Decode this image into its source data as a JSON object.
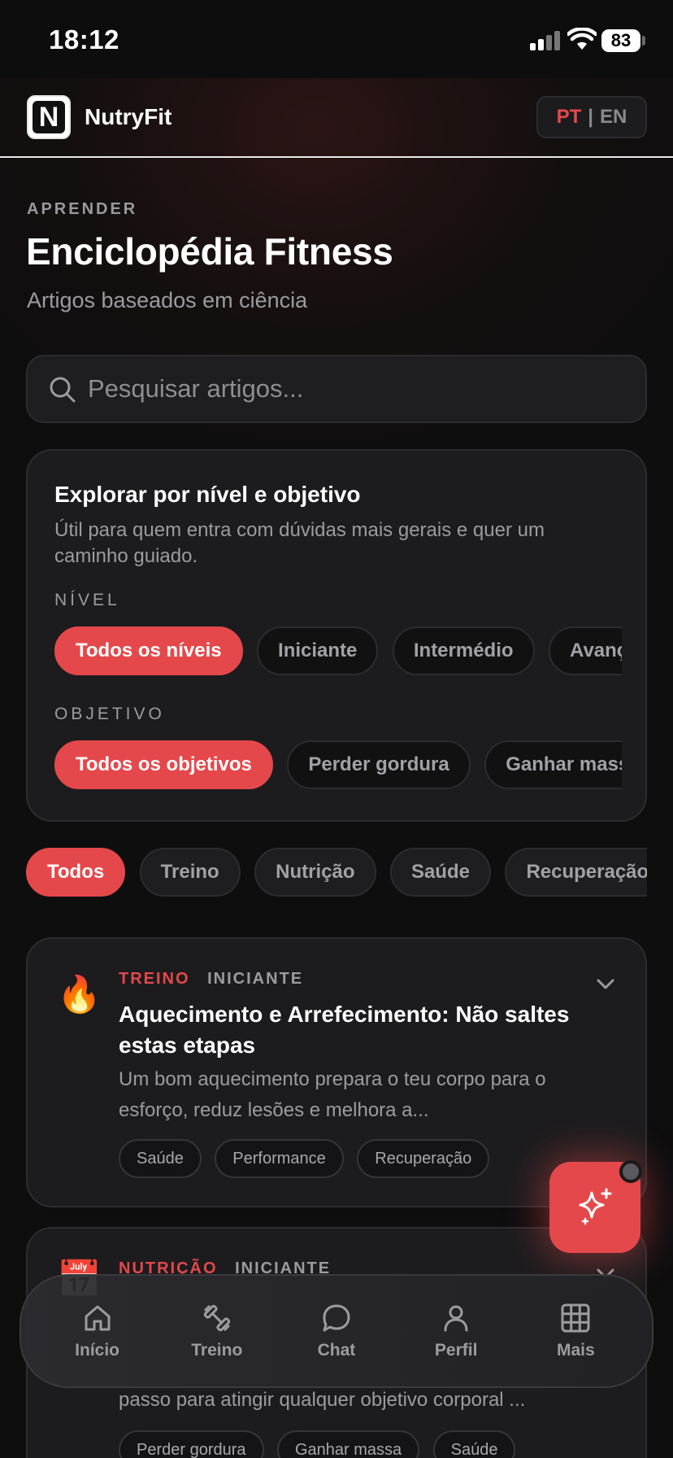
{
  "status_bar": {
    "time": "18:12",
    "battery": "83"
  },
  "header": {
    "brand": "NutryFit",
    "logo_letter": "N",
    "lang_pt": "PT",
    "lang_sep": "|",
    "lang_en": "EN"
  },
  "page": {
    "eyebrow": "APRENDER",
    "title": "Enciclopédia Fitness",
    "subtitle": "Artigos baseados em ciência"
  },
  "search": {
    "placeholder": "Pesquisar artigos..."
  },
  "explore": {
    "title": "Explorar por nível e objetivo",
    "description": "Útil para quem entra com dúvidas mais gerais e quer um caminho guiado.",
    "level_label": "NÍVEL",
    "levels": [
      "Todos os níveis",
      "Iniciante",
      "Intermédio",
      "Avançado"
    ],
    "goal_label": "OBJETIVO",
    "goals": [
      "Todos os objetivos",
      "Perder gordura",
      "Ganhar massa"
    ]
  },
  "categories": [
    "Todos",
    "Treino",
    "Nutrição",
    "Saúde",
    "Recuperação"
  ],
  "articles": [
    {
      "emoji": "🔥",
      "category": "TREINO",
      "level": "INICIANTE",
      "title": "Aquecimento e Arrefecimento: Não saltes estas etapas",
      "description": "Um bom aquecimento prepara o teu corpo para o esforço, reduz lesões e melhora a...",
      "tags": [
        "Saúde",
        "Performance",
        "Recuperação"
      ]
    },
    {
      "emoji": "📅",
      "category": "NUTRIÇÃO",
      "level": "INICIANTE",
      "description_tail": "passo para atingir qualquer objetivo corporal ...",
      "tags": [
        "Perder gordura",
        "Ganhar massa",
        "Saúde"
      ]
    }
  ],
  "bottom_nav": [
    "Início",
    "Treino",
    "Chat",
    "Perfil",
    "Mais"
  ],
  "colors": {
    "accent": "#e5484b",
    "background": "#0e0e0f",
    "card": "#1c1c1e",
    "muted": "#9c9ca0"
  }
}
